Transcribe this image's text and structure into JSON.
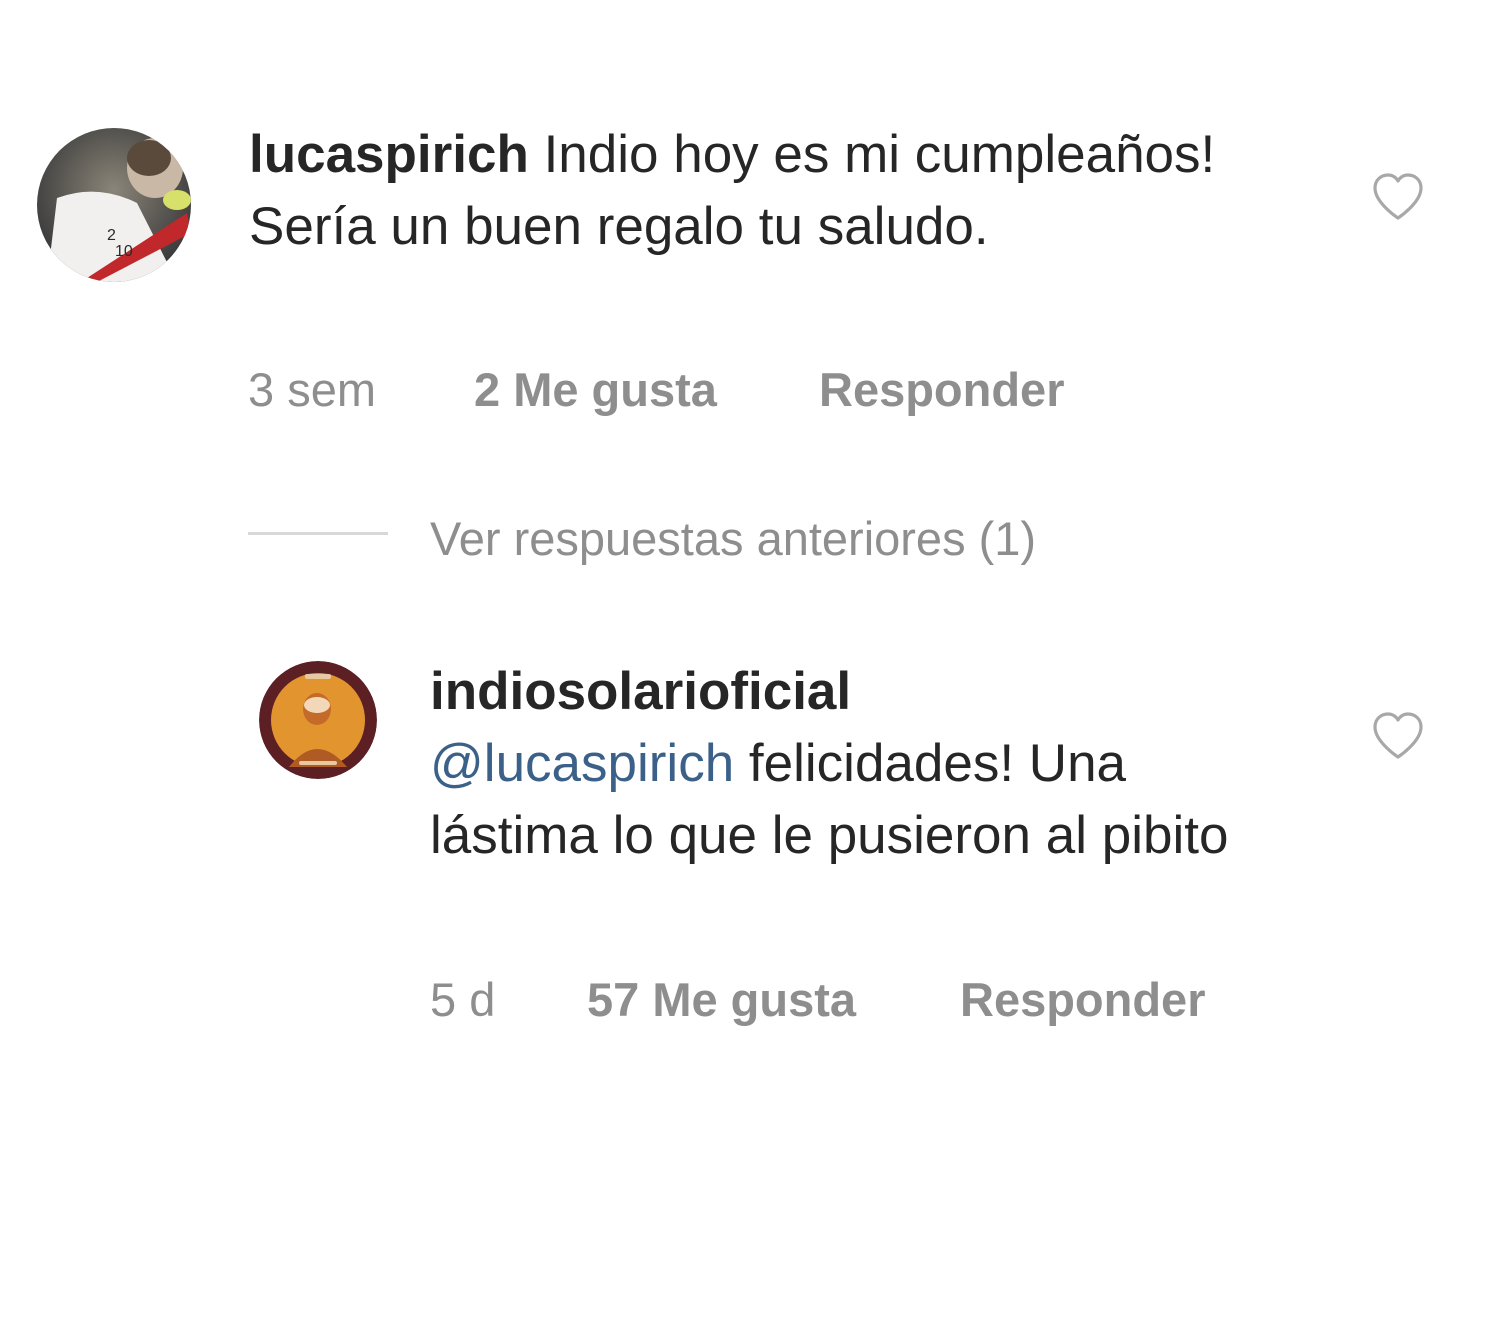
{
  "comment": {
    "username": "lucaspirich",
    "text": " Indio hoy es mi cumpleaños! Sería un buen regalo tu saludo.",
    "time": "3 sem",
    "likes": "2 Me gusta",
    "reply_label": "Responder"
  },
  "view_replies": {
    "label": "Ver respuestas anteriores (1)"
  },
  "reply": {
    "username": "indiosolarioficial",
    "mention": "@lucaspirich",
    "text": " felicidades! Una lástima lo que le pusieron al pibito",
    "time": "5 d",
    "likes": "57 Me gusta",
    "reply_label": "Responder"
  },
  "icons": {
    "like": "heart-outline-icon"
  },
  "colors": {
    "text": "#262626",
    "meta": "#8e8e8e",
    "mention": "#3c6189",
    "divider": "#d8d8d8"
  }
}
